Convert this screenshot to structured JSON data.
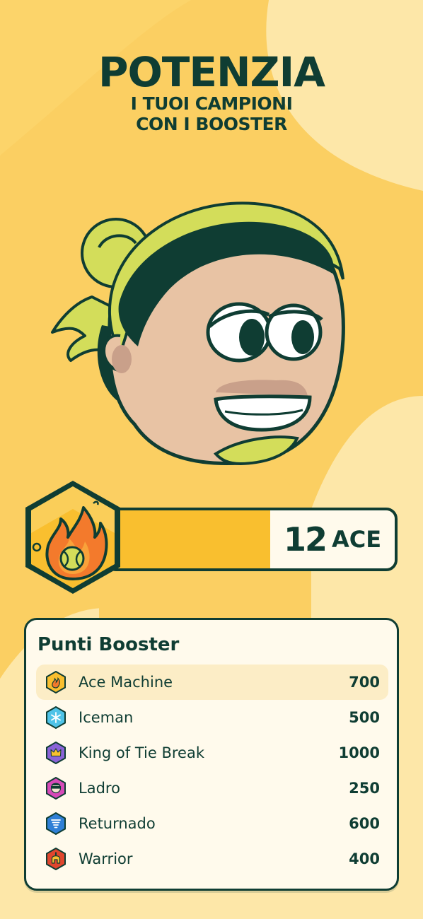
{
  "header": {
    "title": "POTENZIA",
    "subtitle_line1": "I TUOI CAMPIONI",
    "subtitle_line2": "CON I BOOSTER"
  },
  "colors": {
    "background": "#FDE7A8",
    "accent_yellow": "#F9BF2F",
    "dark_green": "#0F3D33",
    "lime": "#D3DD5A",
    "skin": "#E8C3A4",
    "panel": "#FFFAEC"
  },
  "ace_counter": {
    "icon": "fire-tennis-ball-icon",
    "value": "12",
    "unit": "ACE"
  },
  "booster_points": {
    "title": "Punti Booster",
    "items": [
      {
        "icon": "fire-icon",
        "name": "Ace Machine",
        "points": "700",
        "highlighted": true
      },
      {
        "icon": "snowflake-icon",
        "name": "Iceman",
        "points": "500"
      },
      {
        "icon": "crown-icon",
        "name": "King of Tie Break",
        "points": "1000"
      },
      {
        "icon": "mask-icon",
        "name": "Ladro",
        "points": "250"
      },
      {
        "icon": "tornado-icon",
        "name": "Returnado",
        "points": "600"
      },
      {
        "icon": "helmet-icon",
        "name": "Warrior",
        "points": "400"
      }
    ]
  }
}
